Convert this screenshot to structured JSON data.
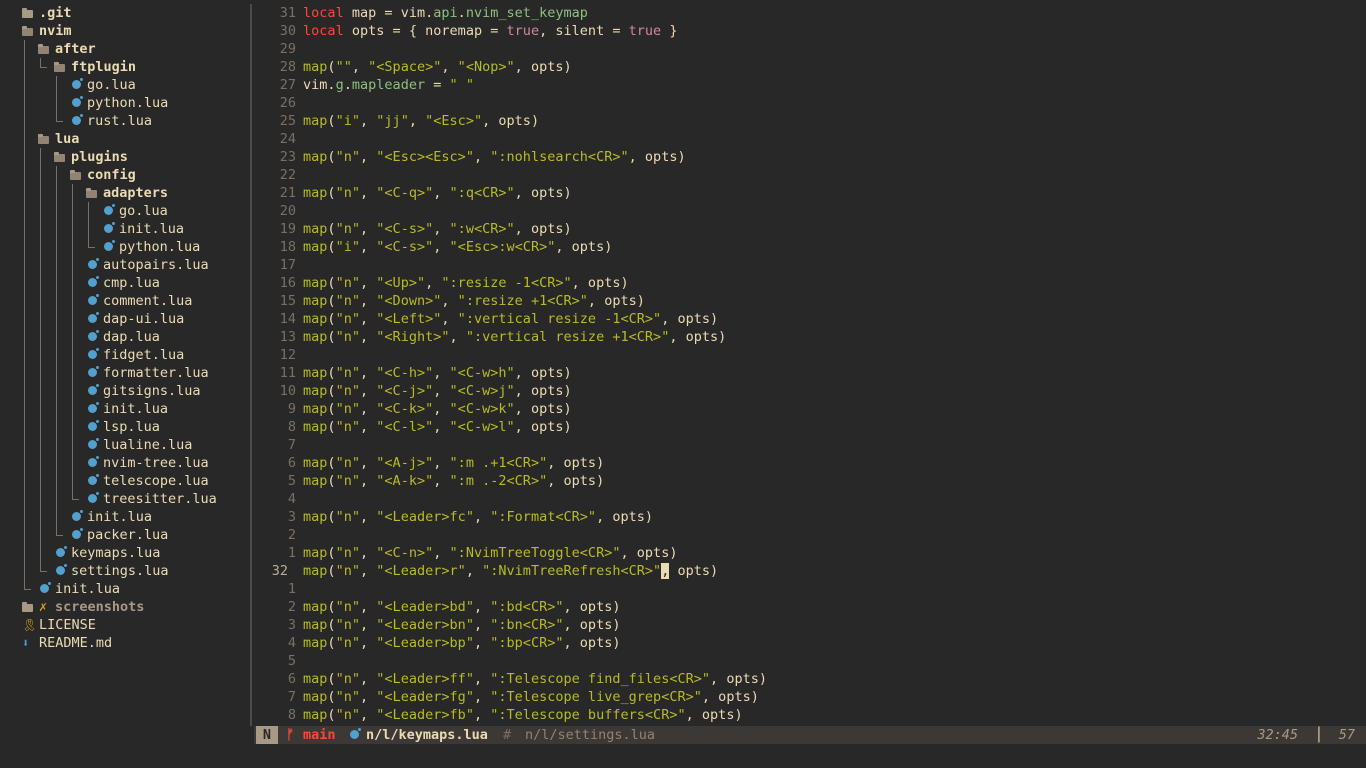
{
  "tree": {
    "items": [
      {
        "label": ".git",
        "type": "dir",
        "icon": "folder-icon",
        "depth": 0
      },
      {
        "label": "nvim",
        "type": "dir-open",
        "icon": "folder-open-icon",
        "depth": 0
      },
      {
        "label": "after",
        "type": "dir-open",
        "icon": "folder-open-icon",
        "depth": 1
      },
      {
        "label": "ftplugin",
        "type": "dir-open",
        "icon": "folder-open-icon",
        "depth": 2
      },
      {
        "label": "go.lua",
        "type": "file",
        "icon": "lua-icon",
        "depth": 3
      },
      {
        "label": "python.lua",
        "type": "file",
        "icon": "lua-icon",
        "depth": 3
      },
      {
        "label": "rust.lua",
        "type": "file",
        "icon": "lua-icon",
        "depth": 3
      },
      {
        "label": "lua",
        "type": "dir-open",
        "icon": "folder-open-icon",
        "depth": 1
      },
      {
        "label": "plugins",
        "type": "dir-open",
        "icon": "folder-open-icon",
        "depth": 2
      },
      {
        "label": "config",
        "type": "dir-open",
        "icon": "folder-open-icon",
        "depth": 3
      },
      {
        "label": "adapters",
        "type": "dir-open",
        "icon": "folder-open-icon",
        "depth": 4
      },
      {
        "label": "go.lua",
        "type": "file",
        "icon": "lua-icon",
        "depth": 5
      },
      {
        "label": "init.lua",
        "type": "file",
        "icon": "lua-icon",
        "depth": 5
      },
      {
        "label": "python.lua",
        "type": "file",
        "icon": "lua-icon",
        "depth": 5
      },
      {
        "label": "autopairs.lua",
        "type": "file",
        "icon": "lua-icon",
        "depth": 4
      },
      {
        "label": "cmp.lua",
        "type": "file",
        "icon": "lua-icon",
        "depth": 4
      },
      {
        "label": "comment.lua",
        "type": "file",
        "icon": "lua-icon",
        "depth": 4
      },
      {
        "label": "dap-ui.lua",
        "type": "file",
        "icon": "lua-icon",
        "depth": 4
      },
      {
        "label": "dap.lua",
        "type": "file",
        "icon": "lua-icon",
        "depth": 4
      },
      {
        "label": "fidget.lua",
        "type": "file",
        "icon": "lua-icon",
        "depth": 4
      },
      {
        "label": "formatter.lua",
        "type": "file",
        "icon": "lua-icon",
        "depth": 4
      },
      {
        "label": "gitsigns.lua",
        "type": "file",
        "icon": "lua-icon",
        "depth": 4
      },
      {
        "label": "init.lua",
        "type": "file",
        "icon": "lua-icon",
        "depth": 4
      },
      {
        "label": "lsp.lua",
        "type": "file",
        "icon": "lua-icon",
        "depth": 4
      },
      {
        "label": "lualine.lua",
        "type": "file",
        "icon": "lua-icon",
        "depth": 4
      },
      {
        "label": "nvim-tree.lua",
        "type": "file",
        "icon": "lua-icon",
        "depth": 4
      },
      {
        "label": "telescope.lua",
        "type": "file",
        "icon": "lua-icon",
        "depth": 4
      },
      {
        "label": "treesitter.lua",
        "type": "file",
        "icon": "lua-icon",
        "depth": 4
      },
      {
        "label": "init.lua",
        "type": "file",
        "icon": "lua-icon",
        "depth": 3
      },
      {
        "label": "packer.lua",
        "type": "file",
        "icon": "lua-icon",
        "depth": 3
      },
      {
        "label": "keymaps.lua",
        "type": "file",
        "icon": "lua-icon",
        "depth": 2
      },
      {
        "label": "settings.lua",
        "type": "file",
        "icon": "lua-icon",
        "depth": 2
      },
      {
        "label": "init.lua",
        "type": "file",
        "icon": "lua-icon",
        "depth": 1
      },
      {
        "label": "screenshots",
        "type": "dir",
        "icon": "folder-icon",
        "depth": 0,
        "marker": "✗"
      },
      {
        "label": "LICENSE",
        "type": "file",
        "icon": "license-icon",
        "depth": 0
      },
      {
        "label": "README.md",
        "type": "file",
        "icon": "markdown-icon",
        "depth": 0
      }
    ]
  },
  "editor": {
    "lines": [
      {
        "num": "31",
        "text": "local map = vim.api.nvim_set_keymap"
      },
      {
        "num": "30",
        "text": "local opts = { noremap = true, silent = true }"
      },
      {
        "num": "29",
        "text": ""
      },
      {
        "num": "28",
        "text": "map(\"\", \"<Space>\", \"<Nop>\", opts)"
      },
      {
        "num": "27",
        "text": "vim.g.mapleader = \" \""
      },
      {
        "num": "26",
        "text": ""
      },
      {
        "num": "25",
        "text": "map(\"i\", \"jj\", \"<Esc>\", opts)"
      },
      {
        "num": "24",
        "text": ""
      },
      {
        "num": "23",
        "text": "map(\"n\", \"<Esc><Esc>\", \":nohlsearch<CR>\", opts)"
      },
      {
        "num": "22",
        "text": ""
      },
      {
        "num": "21",
        "text": "map(\"n\", \"<C-q>\", \":q<CR>\", opts)"
      },
      {
        "num": "20",
        "text": ""
      },
      {
        "num": "19",
        "text": "map(\"n\", \"<C-s>\", \":w<CR>\", opts)"
      },
      {
        "num": "18",
        "text": "map(\"i\", \"<C-s>\", \"<Esc>:w<CR>\", opts)"
      },
      {
        "num": "17",
        "text": ""
      },
      {
        "num": "16",
        "text": "map(\"n\", \"<Up>\", \":resize -1<CR>\", opts)"
      },
      {
        "num": "15",
        "text": "map(\"n\", \"<Down>\", \":resize +1<CR>\", opts)"
      },
      {
        "num": "14",
        "text": "map(\"n\", \"<Left>\", \":vertical resize -1<CR>\", opts)"
      },
      {
        "num": "13",
        "text": "map(\"n\", \"<Right>\", \":vertical resize +1<CR>\", opts)"
      },
      {
        "num": "12",
        "text": ""
      },
      {
        "num": "11",
        "text": "map(\"n\", \"<C-h>\", \"<C-w>h\", opts)"
      },
      {
        "num": "10",
        "text": "map(\"n\", \"<C-j>\", \"<C-w>j\", opts)"
      },
      {
        "num": "9",
        "text": "map(\"n\", \"<C-k>\", \"<C-w>k\", opts)"
      },
      {
        "num": "8",
        "text": "map(\"n\", \"<C-l>\", \"<C-w>l\", opts)"
      },
      {
        "num": "7",
        "text": ""
      },
      {
        "num": "6",
        "text": "map(\"n\", \"<A-j>\", \":m .+1<CR>\", opts)"
      },
      {
        "num": "5",
        "text": "map(\"n\", \"<A-k>\", \":m .-2<CR>\", opts)"
      },
      {
        "num": "4",
        "text": ""
      },
      {
        "num": "3",
        "text": "map(\"n\", \"<Leader>fc\", \":Format<CR>\", opts)"
      },
      {
        "num": "2",
        "text": ""
      },
      {
        "num": "1",
        "text": "map(\"n\", \"<C-n>\", \":NvimTreeToggle<CR>\", opts)"
      },
      {
        "num": "32",
        "text": "map(\"n\", \"<Leader>r\", \":NvimTreeRefresh<CR>\", opts)",
        "current": true
      },
      {
        "num": "1",
        "text": ""
      },
      {
        "num": "2",
        "text": "map(\"n\", \"<Leader>bd\", \":bd<CR>\", opts)"
      },
      {
        "num": "3",
        "text": "map(\"n\", \"<Leader>bn\", \":bn<CR>\", opts)"
      },
      {
        "num": "4",
        "text": "map(\"n\", \"<Leader>bp\", \":bp<CR>\", opts)"
      },
      {
        "num": "5",
        "text": ""
      },
      {
        "num": "6",
        "text": "map(\"n\", \"<Leader>ff\", \":Telescope find_files<CR>\", opts)"
      },
      {
        "num": "7",
        "text": "map(\"n\", \"<Leader>fg\", \":Telescope live_grep<CR>\", opts)"
      },
      {
        "num": "8",
        "text": "map(\"n\", \"<Leader>fb\", \":Telescope buffers<CR>\", opts)"
      }
    ]
  },
  "statusline": {
    "mode": "N",
    "branch_icon": "git-branch-icon",
    "branch_glyph": "ᚠ",
    "branch": "main",
    "buffer1_icon": "lua-icon",
    "buffer1": "n/l/keymaps.lua",
    "buffer2_prefix": "#",
    "buffer2": "n/l/settings.lua",
    "position": "32:45",
    "separator": "│",
    "percent": "57"
  },
  "colors": {
    "background": "#282828",
    "keyword": "#fb4934",
    "string": "#b8bb26",
    "property": "#8ec07c",
    "boolean": "#d3869b",
    "lua_icon": "#51a0cf"
  }
}
